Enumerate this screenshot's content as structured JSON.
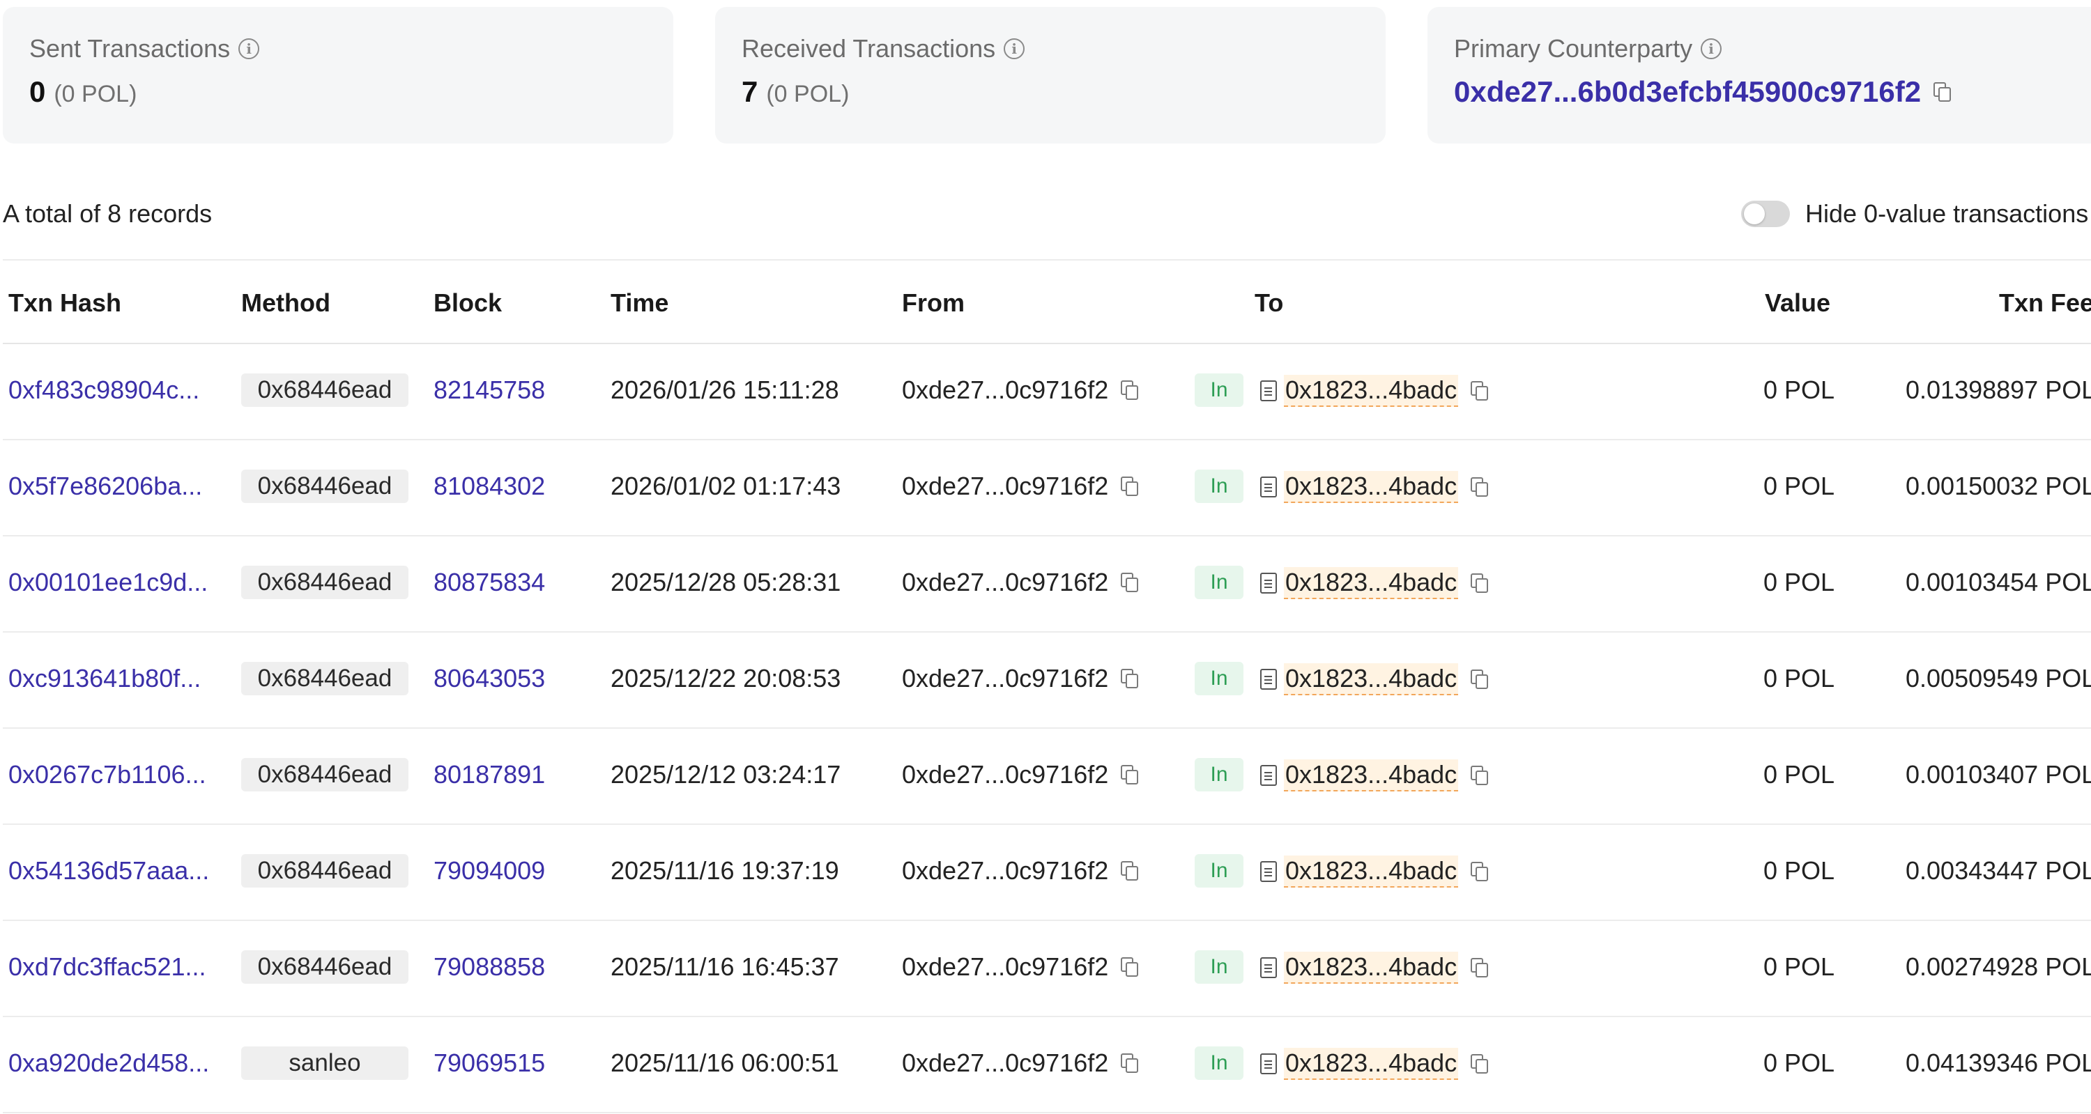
{
  "cards": {
    "sent": {
      "label": "Sent Transactions",
      "count": "0",
      "sub": "(0 POL)"
    },
    "received": {
      "label": "Received Transactions",
      "count": "7",
      "sub": "(0 POL)"
    },
    "counterparty": {
      "label": "Primary Counterparty",
      "address": "0xde27...6b0d3efcbf45900c9716f2"
    }
  },
  "toolbar": {
    "records_text": "A total of 8 records",
    "toggle_label": "Hide 0-value transactions",
    "toggle_on": false
  },
  "table": {
    "headers": {
      "hash": "Txn Hash",
      "method": "Method",
      "block": "Block",
      "time": "Time",
      "from": "From",
      "to": "To",
      "value": "Value",
      "fee": "Txn Fee"
    },
    "rows": [
      {
        "hash": "0xf483c98904c...",
        "method": "0x68446ead",
        "block": "82145758",
        "time": "2026/01/26 15:11:28",
        "from": "0xde27...0c9716f2",
        "direction": "In",
        "to": "0x1823...4badc",
        "value": "0 POL",
        "fee": "0.01398897 POL"
      },
      {
        "hash": "0x5f7e86206ba...",
        "method": "0x68446ead",
        "block": "81084302",
        "time": "2026/01/02 01:17:43",
        "from": "0xde27...0c9716f2",
        "direction": "In",
        "to": "0x1823...4badc",
        "value": "0 POL",
        "fee": "0.00150032 POL"
      },
      {
        "hash": "0x00101ee1c9d...",
        "method": "0x68446ead",
        "block": "80875834",
        "time": "2025/12/28 05:28:31",
        "from": "0xde27...0c9716f2",
        "direction": "In",
        "to": "0x1823...4badc",
        "value": "0 POL",
        "fee": "0.00103454 POL"
      },
      {
        "hash": "0xc913641b80f...",
        "method": "0x68446ead",
        "block": "80643053",
        "time": "2025/12/22 20:08:53",
        "from": "0xde27...0c9716f2",
        "direction": "In",
        "to": "0x1823...4badc",
        "value": "0 POL",
        "fee": "0.00509549 POL"
      },
      {
        "hash": "0x0267c7b1106...",
        "method": "0x68446ead",
        "block": "80187891",
        "time": "2025/12/12 03:24:17",
        "from": "0xde27...0c9716f2",
        "direction": "In",
        "to": "0x1823...4badc",
        "value": "0 POL",
        "fee": "0.00103407 POL"
      },
      {
        "hash": "0x54136d57aaa...",
        "method": "0x68446ead",
        "block": "79094009",
        "time": "2025/11/16 19:37:19",
        "from": "0xde27...0c9716f2",
        "direction": "In",
        "to": "0x1823...4badc",
        "value": "0 POL",
        "fee": "0.00343447 POL"
      },
      {
        "hash": "0xd7dc3ffac521...",
        "method": "0x68446ead",
        "block": "79088858",
        "time": "2025/11/16 16:45:37",
        "from": "0xde27...0c9716f2",
        "direction": "In",
        "to": "0x1823...4badc",
        "value": "0 POL",
        "fee": "0.00274928 POL"
      },
      {
        "hash": "0xa920de2d458...",
        "method": "sanleo",
        "block": "79069515",
        "time": "2025/11/16 06:00:51",
        "from": "0xde27...0c9716f2",
        "direction": "In",
        "to": "0x1823...4badc",
        "value": "0 POL",
        "fee": "0.04139346 POL"
      }
    ]
  },
  "colors": {
    "link": "#3a2fa8",
    "in_badge_bg": "#e7f6ec",
    "in_badge_text": "#2e9e55",
    "card_bg": "#f5f6f7"
  }
}
